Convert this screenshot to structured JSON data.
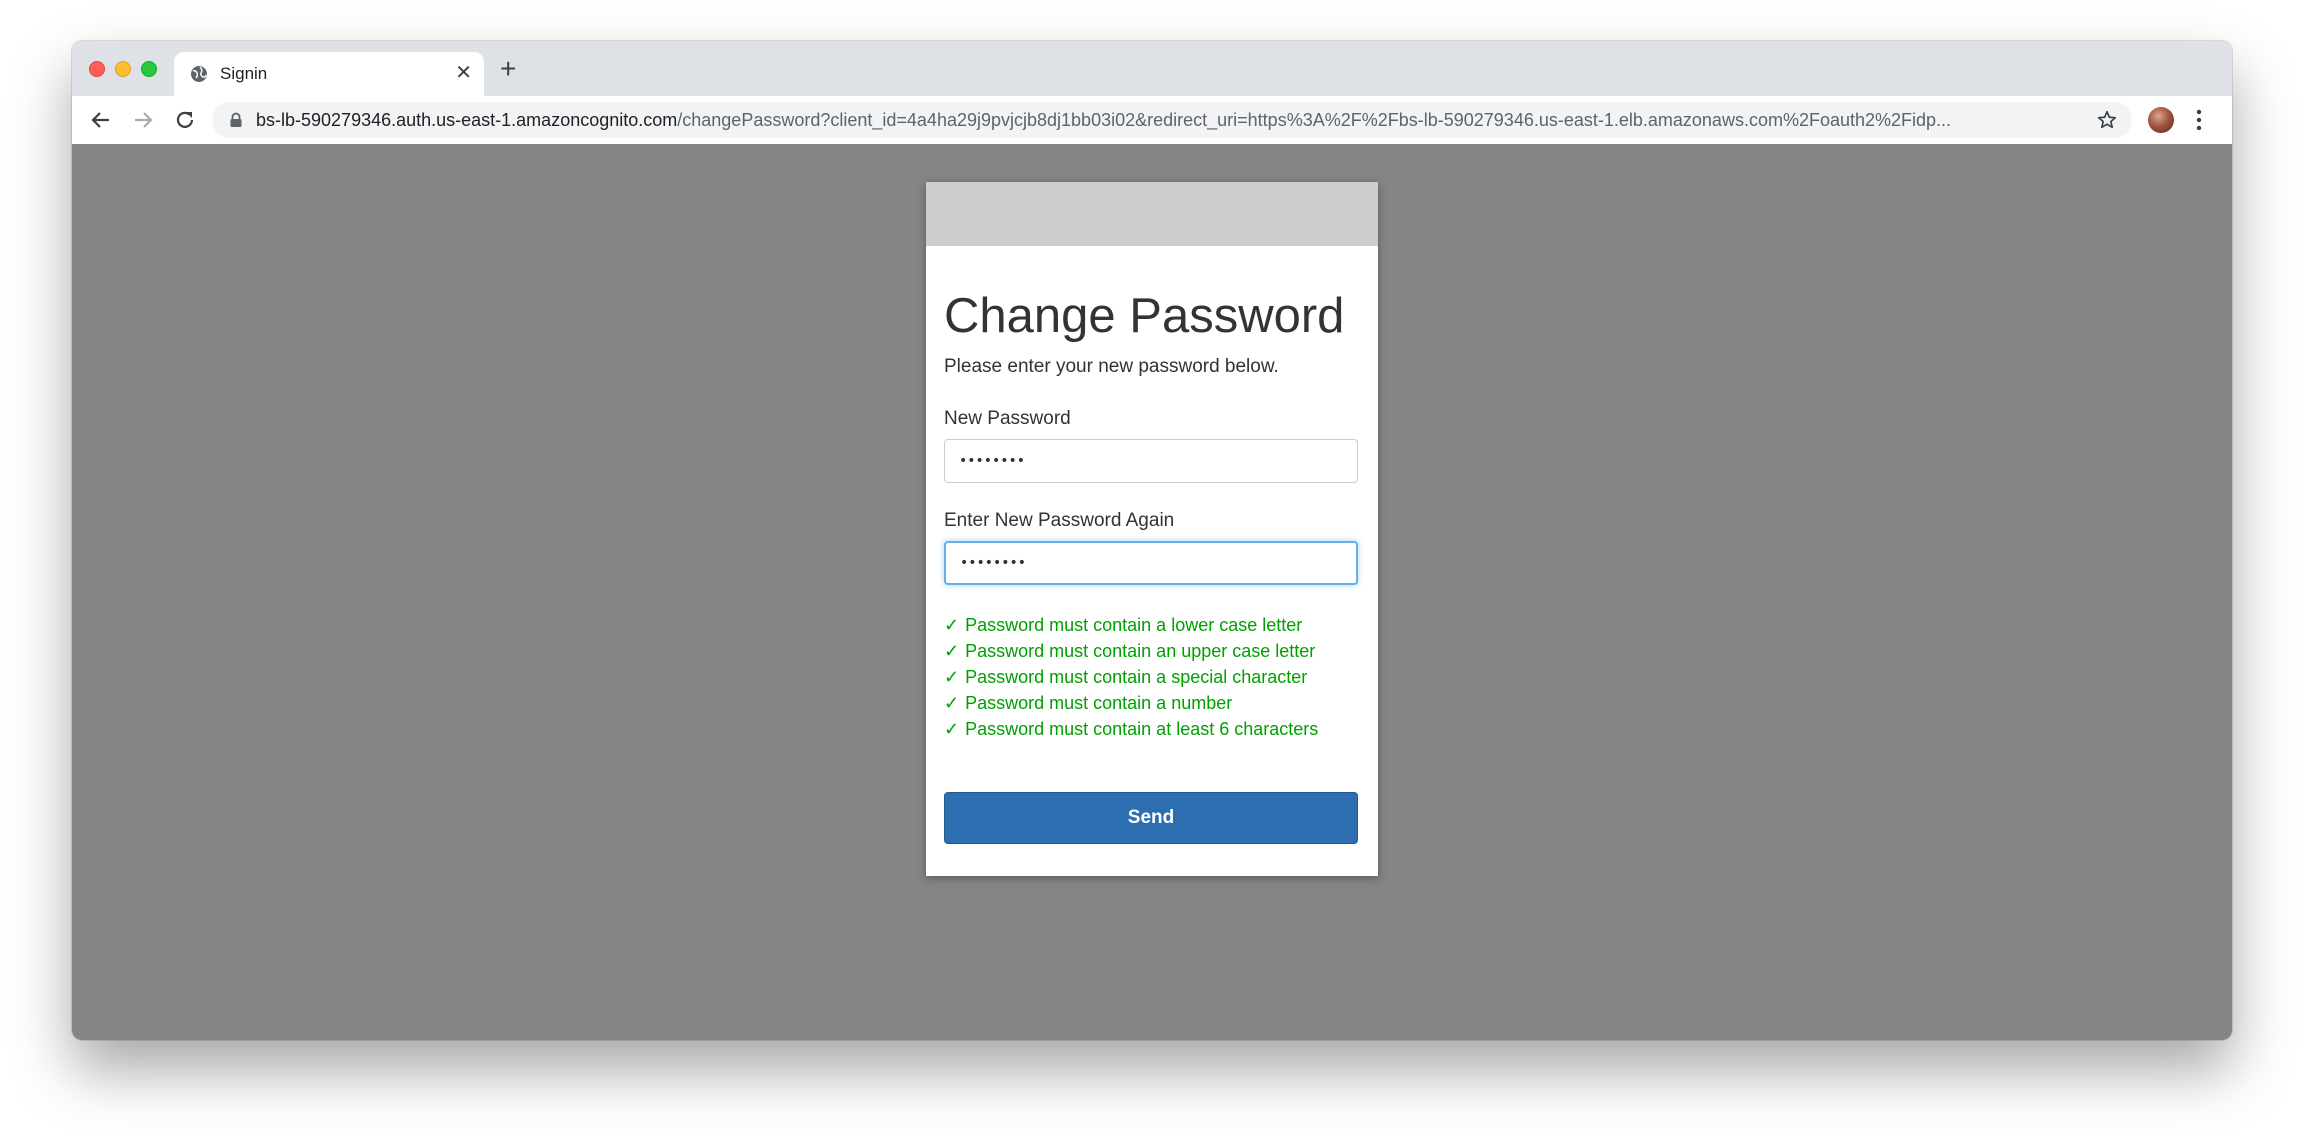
{
  "browser": {
    "tab": {
      "title": "Signin",
      "close_glyph": "✕",
      "favicon": "globe-icon"
    },
    "new_tab_glyph": "+",
    "address": {
      "host": "bs-lb-590279346.auth.us-east-1.amazoncognito.com",
      "path": "/changePassword?client_id=4a4ha29j9pvjcjb8dj1bb03i02&redirect_uri=https%3A%2F%2Fbs-lb-590279346.us-east-1.elb.amazonaws.com%2Foauth2%2Fidp..."
    }
  },
  "form": {
    "title": "Change Password",
    "subtitle": "Please enter your new password below.",
    "new_password": {
      "label": "New Password",
      "value": "••••••••"
    },
    "confirm_password": {
      "label": "Enter New Password Again",
      "value": "••••••••"
    },
    "check_glyph": "✓",
    "rules": [
      "Password must contain a lower case letter",
      "Password must contain an upper case letter",
      "Password must contain a special character",
      "Password must contain a number",
      "Password must contain at least 6 characters"
    ],
    "submit_label": "Send"
  },
  "colors": {
    "page_overlay": "#858585",
    "banner": "#cccccc",
    "rule_ok": "#00a000",
    "primary_button": "#2d6eb0",
    "focus_ring": "#66afe9"
  }
}
